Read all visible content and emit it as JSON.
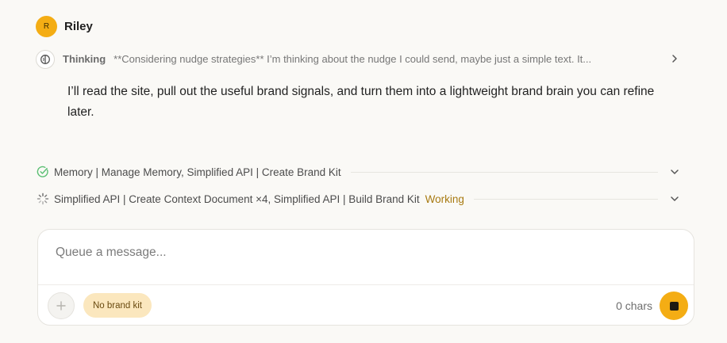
{
  "user": {
    "avatar_initial": "R",
    "name": "Riley"
  },
  "thinking": {
    "label": "Thinking",
    "text": "**Considering nudge strategies** I’m thinking about the nudge I could send, maybe just a simple text. It...",
    "icon": "brain-icon"
  },
  "message": {
    "text": "I’ll read the site, pull out the useful brand signals, and turn them into a lightweight brand brain you can refine later."
  },
  "tool_rows": [
    {
      "text": "Memory | Manage Memory, Simplified API | Create Brand Kit",
      "status": "",
      "icon": "check-circle-icon"
    },
    {
      "text": "Simplified API | Create Context Document ×4, Simplified API | Build Brand Kit",
      "status": "Working",
      "icon": "spinner-icon"
    }
  ],
  "composer": {
    "placeholder": "Queue a message...",
    "value": "",
    "chip_label": "No brand kit",
    "char_count": "0 chars"
  },
  "colors": {
    "accent": "#f4ad14",
    "working": "#a87a12",
    "success": "#5bbf73",
    "chip_bg": "#fbe7be"
  }
}
